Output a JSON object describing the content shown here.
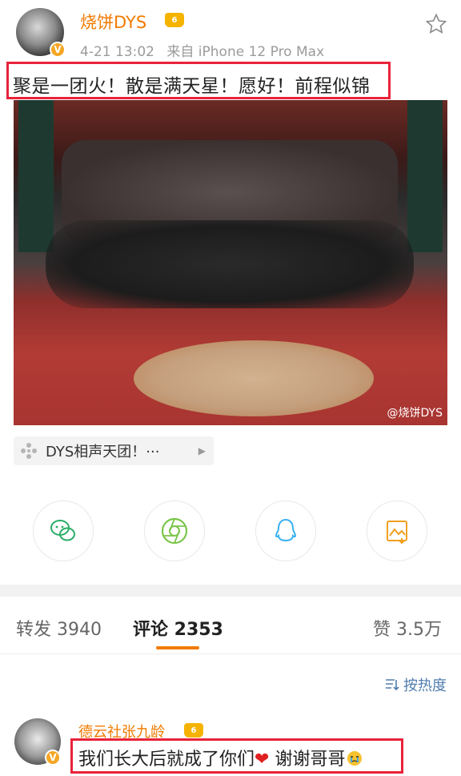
{
  "post": {
    "author": "烧饼DYS",
    "time": "4-21 13:02",
    "source": "来自 iPhone 12 Pro Max",
    "text": "聚是一团火！散是满天星！愿好！前程似锦",
    "watermark": "@烧饼DYS",
    "topic": "DYS相声天团！···",
    "icons": {
      "follow": "star-outline-icon",
      "verified": "verified-v-icon",
      "vip": "crown-vip-icon"
    }
  },
  "share": [
    {
      "name": "wechat-share-icon",
      "color": "#2aae67"
    },
    {
      "name": "moments-share-icon",
      "color": "#7bc54a"
    },
    {
      "name": "qq-share-icon",
      "color": "#3ab0f0"
    },
    {
      "name": "save-image-icon",
      "color": "#f0a020"
    }
  ],
  "tabs": {
    "repost": "转发 3940",
    "comments": "评论 2353",
    "likes": "赞 3.5万"
  },
  "sort_label": "按热度",
  "comment": {
    "author": "德云社张九龄",
    "text": "我们长大后就成了你们",
    "text_after": " 谢谢哥哥"
  },
  "colors": {
    "accent": "#f07b00",
    "highlight_box": "#e8233a",
    "link": "#507daf"
  }
}
